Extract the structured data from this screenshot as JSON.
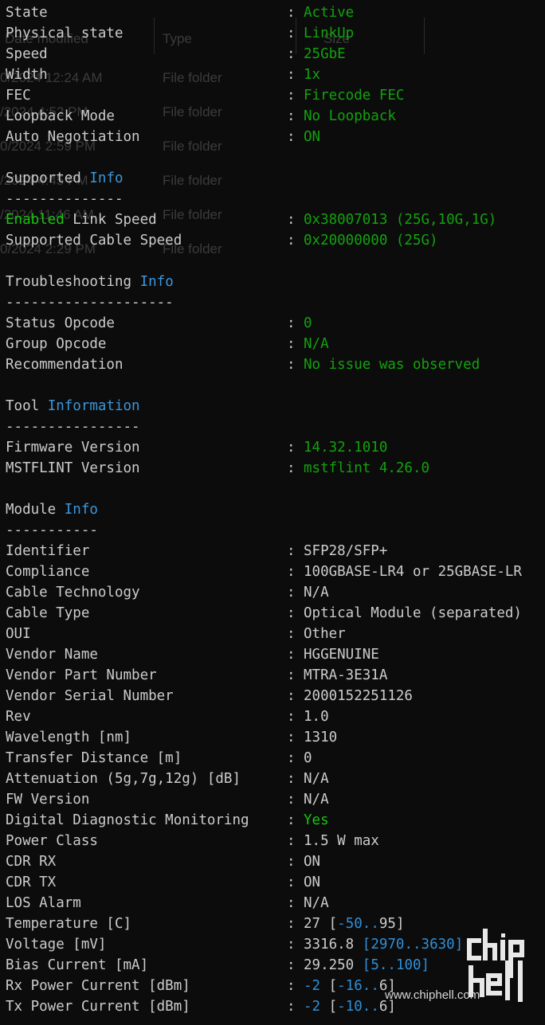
{
  "ghost_window": {
    "header_name": "Date modified",
    "header_type": "Type",
    "header_size": "Size",
    "rows": [
      {
        "date": "0/2024 12:24 AM",
        "type": "File folder"
      },
      {
        "date": "/2024 4:52 PM",
        "type": "File folder"
      },
      {
        "date": "0/2024 2:59 PM",
        "type": "File folder"
      },
      {
        "date": "/2024 4:45 PM",
        "type": "File folder"
      },
      {
        "date": "/2024 11:46 AM",
        "type": "File folder"
      },
      {
        "date": "0/2024 2:29 PM",
        "type": "File folder"
      }
    ]
  },
  "colors": {
    "background": "#0c0c0c",
    "text": "#cccccc",
    "value_green": "#13a10e",
    "bright_green": "#16c60c",
    "info_cyan": "#3a96dd",
    "range_blue": "#2f8fd8"
  },
  "lines": [
    {
      "type": "kv",
      "key": "State",
      "value": "Active",
      "value_color": "green"
    },
    {
      "type": "kv",
      "key": "Physical state",
      "value": "LinkUp",
      "value_color": "green"
    },
    {
      "type": "kv",
      "key": "Speed",
      "value": "25GbE",
      "value_color": "green"
    },
    {
      "type": "kv",
      "key": "Width",
      "value": "1x",
      "value_color": "green"
    },
    {
      "type": "kv",
      "key": "FEC",
      "value": "Firecode FEC",
      "value_color": "green"
    },
    {
      "type": "kv",
      "key": "Loopback Mode",
      "value": "No Loopback",
      "value_color": "green"
    },
    {
      "type": "kv",
      "key": "Auto Negotiation",
      "value": "ON",
      "value_color": "green"
    },
    {
      "type": "blank"
    },
    {
      "type": "header",
      "a": "Supported",
      "b": "Info"
    },
    {
      "type": "divider",
      "text": "--------------"
    },
    {
      "type": "kv",
      "key_hi": "Enabled",
      "key_rest": " Link Speed",
      "key": "",
      "value": "0x38007013 (25G,10G,1G)",
      "value_color": "green"
    },
    {
      "type": "kv",
      "key": "Supported Cable Speed",
      "value": "0x20000000 (25G)",
      "value_color": "green"
    },
    {
      "type": "blank"
    },
    {
      "type": "header",
      "a": "Troubleshooting",
      "b": "Info"
    },
    {
      "type": "divider",
      "text": "--------------------"
    },
    {
      "type": "kv",
      "key": "Status Opcode",
      "value": "0",
      "value_color": "green"
    },
    {
      "type": "kv",
      "key": "Group Opcode",
      "value": "N/A",
      "value_color": "green"
    },
    {
      "type": "kv",
      "key": "Recommendation",
      "value": "No issue was observed",
      "value_color": "green"
    },
    {
      "type": "blank"
    },
    {
      "type": "header",
      "a": "Tool",
      "b": "Information"
    },
    {
      "type": "divider",
      "text": "----------------"
    },
    {
      "type": "kv",
      "key": "Firmware Version",
      "value": "14.32.1010",
      "value_color": "green"
    },
    {
      "type": "kv",
      "key": "MSTFLINT Version",
      "value": "mstflint 4.26.0",
      "value_color": "green"
    },
    {
      "type": "blank"
    },
    {
      "type": "header",
      "a": "Module",
      "b": "Info"
    },
    {
      "type": "divider",
      "text": "-----------"
    },
    {
      "type": "kv",
      "key": "Identifier",
      "value": "SFP28/SFP+",
      "value_color": "white"
    },
    {
      "type": "kv",
      "key": "Compliance",
      "value": "100GBASE-LR4 or 25GBASE-LR",
      "value_color": "white"
    },
    {
      "type": "kv",
      "key": "Cable Technology",
      "value": "N/A",
      "value_color": "white"
    },
    {
      "type": "kv",
      "key": "Cable Type",
      "value": "Optical Module (separated)",
      "value_color": "white"
    },
    {
      "type": "kv",
      "key": "OUI",
      "value": "Other",
      "value_color": "white"
    },
    {
      "type": "kv",
      "key": "Vendor Name",
      "value": "HGGENUINE",
      "value_color": "white"
    },
    {
      "type": "kv",
      "key": "Vendor Part Number",
      "value": "MTRA-3E31A",
      "value_color": "white"
    },
    {
      "type": "kv",
      "key": "Vendor Serial Number",
      "value": "2000152251126",
      "value_color": "white"
    },
    {
      "type": "kv",
      "key": "Rev",
      "value": "1.0",
      "value_color": "white"
    },
    {
      "type": "kv",
      "key": "Wavelength [nm]",
      "value": "1310",
      "value_color": "white"
    },
    {
      "type": "kv",
      "key": "Transfer Distance [m]",
      "value": "0",
      "value_color": "white"
    },
    {
      "type": "kv",
      "key": "Attenuation (5g,7g,12g) [dB]",
      "value": "N/A",
      "value_color": "white"
    },
    {
      "type": "kv",
      "key": "FW Version",
      "value": "N/A",
      "value_color": "white"
    },
    {
      "type": "kv",
      "key": "Digital Diagnostic Monitoring",
      "value": "Yes",
      "value_color": "bright"
    },
    {
      "type": "kv",
      "key": "Power Class",
      "value": "1.5 W max",
      "value_color": "white"
    },
    {
      "type": "kv",
      "key": "CDR RX",
      "value": "ON",
      "value_color": "white"
    },
    {
      "type": "kv",
      "key": "CDR TX",
      "value": "ON",
      "value_color": "white"
    },
    {
      "type": "kv",
      "key": "LOS Alarm",
      "value": "N/A",
      "value_color": "white"
    },
    {
      "type": "range",
      "key": "Temperature [C]",
      "val": "27",
      "lo": "-50",
      "hi": "95",
      "lo_blue": true,
      "hi_blue": false
    },
    {
      "type": "range",
      "key": "Voltage [mV]",
      "val": "3316.8",
      "lo": "2970",
      "hi": "3630",
      "lo_blue": true,
      "hi_blue": true,
      "all_blue": true
    },
    {
      "type": "range",
      "key": "Bias Current [mA]",
      "val": "29.250",
      "lo": "5",
      "hi": "100",
      "lo_blue": true,
      "hi_blue": true,
      "all_blue": true
    },
    {
      "type": "range",
      "key": "Rx Power Current [dBm]",
      "val": "-2",
      "val_blue": true,
      "lo": "-16",
      "hi": "6",
      "lo_blue": true,
      "hi_blue": false
    },
    {
      "type": "range",
      "key": "Tx Power Current [dBm]",
      "val": "-2",
      "val_blue": true,
      "lo": "-10",
      "hi": "6",
      "lo_blue": true,
      "hi_blue": false
    }
  ],
  "watermark": {
    "logo_text_top": "chip",
    "logo_text_bottom": "hell",
    "url": "www.chiphell.com"
  }
}
